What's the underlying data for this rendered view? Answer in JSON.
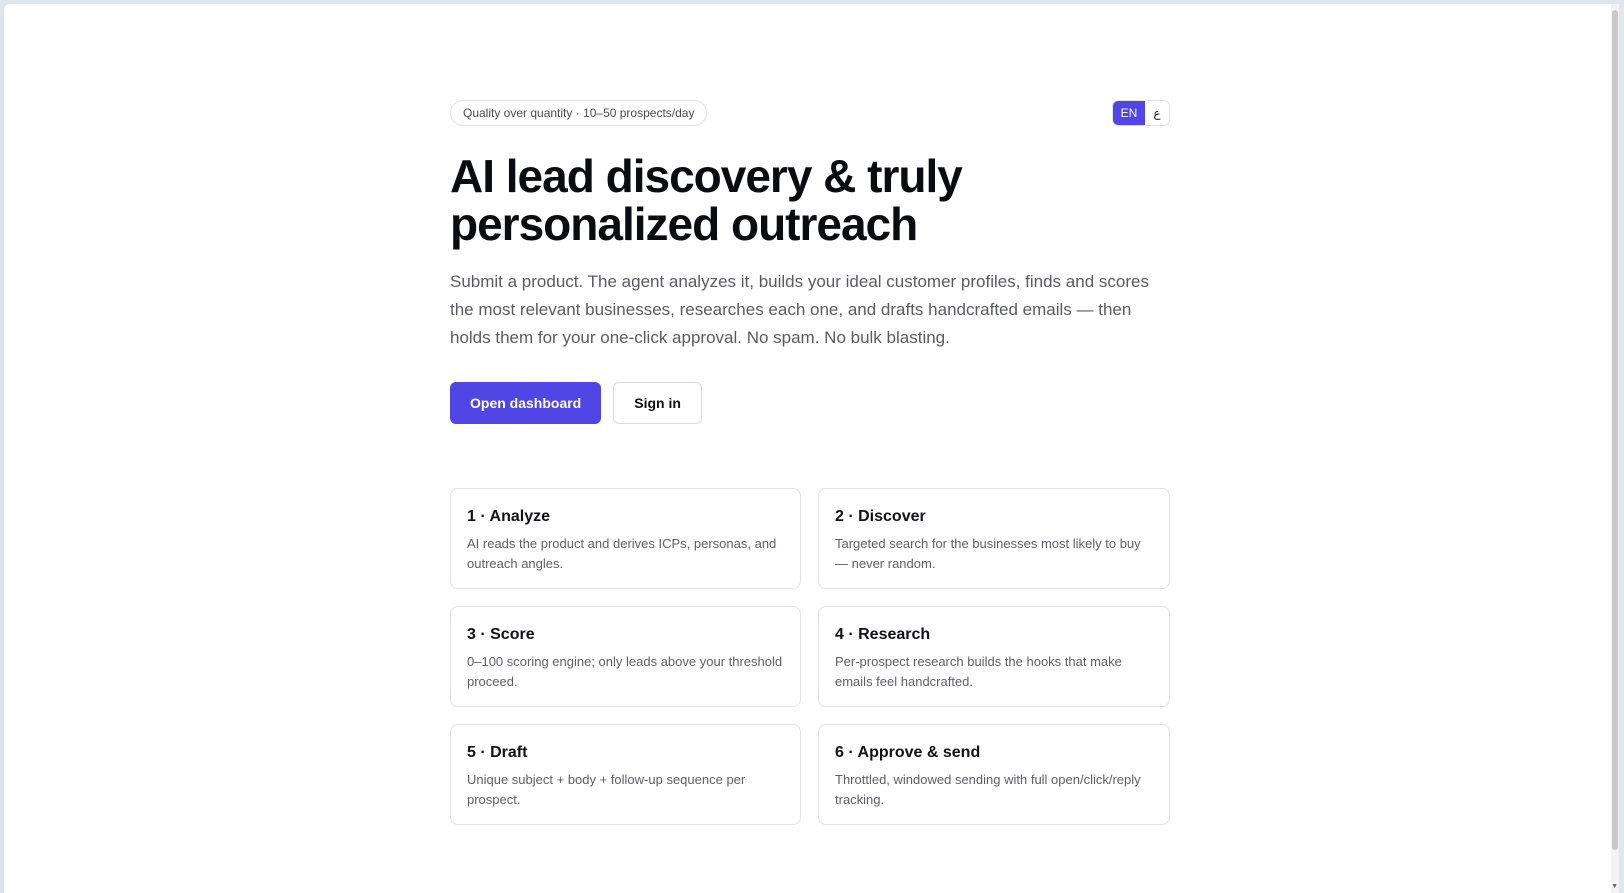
{
  "header": {
    "tagline": "Quality over quantity · 10–50 prospects/day",
    "languages": [
      {
        "label": "EN",
        "active": true
      },
      {
        "label": "ع",
        "active": false
      }
    ]
  },
  "hero": {
    "title": "AI lead discovery & truly personalized outreach",
    "subtitle": "Submit a product. The agent analyzes it, builds your ideal customer profiles, finds and scores the most relevant businesses, researches each one, and drafts handcrafted emails — then holds them for your one-click approval. No spam. No bulk blasting."
  },
  "actions": {
    "primary_label": "Open dashboard",
    "secondary_label": "Sign in"
  },
  "steps": [
    {
      "title": "1 · Analyze",
      "description": "AI reads the product and derives ICPs, personas, and outreach angles."
    },
    {
      "title": "2 · Discover",
      "description": "Targeted search for the businesses most likely to buy — never random."
    },
    {
      "title": "3 · Score",
      "description": "0–100 scoring engine; only leads above your threshold proceed."
    },
    {
      "title": "4 · Research",
      "description": "Per-prospect research builds the hooks that make emails feel handcrafted."
    },
    {
      "title": "5 · Draft",
      "description": "Unique subject + body + follow-up sequence per prospect."
    },
    {
      "title": "6 · Approve & send",
      "description": "Throttled, windowed sending with full open/click/reply tracking."
    }
  ],
  "theme": {
    "accent": "#4f46e5",
    "text": "#0b0b12",
    "muted": "#5a5a66",
    "border": "#e2e2e8"
  }
}
